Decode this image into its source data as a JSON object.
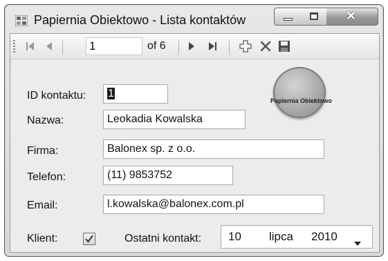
{
  "window": {
    "title": "Papiernia Obiektowo - Lista kontaktów"
  },
  "toolbar": {
    "position": "1",
    "of_label": "of 6"
  },
  "form": {
    "id_label": "ID kontaktu:",
    "id_value": "1",
    "name_label": "Nazwa:",
    "name_value": "Leokadia Kowalska",
    "company_label": "Firma:",
    "company_value": "Balonex sp. z o.o.",
    "phone_label": "Telefon:",
    "phone_value": "(11) 9853752",
    "email_label": "Email:",
    "email_value": "l.kowalska@balonex.com.pl",
    "client_label": "Klient:",
    "client_checked": true,
    "last_contact_label": "Ostatni kontakt:",
    "last_contact": {
      "day": "10",
      "month": "lipca",
      "year": "2010"
    }
  },
  "logo": {
    "text": "Papiernia Obiektowo"
  },
  "icons": [
    "app-icon",
    "minimize-icon",
    "maximize-icon",
    "close-icon",
    "first-record-icon",
    "previous-record-icon",
    "next-record-icon",
    "last-record-icon",
    "add-icon",
    "delete-icon",
    "save-icon",
    "checkmark-icon",
    "dropdown-arrow-icon"
  ]
}
